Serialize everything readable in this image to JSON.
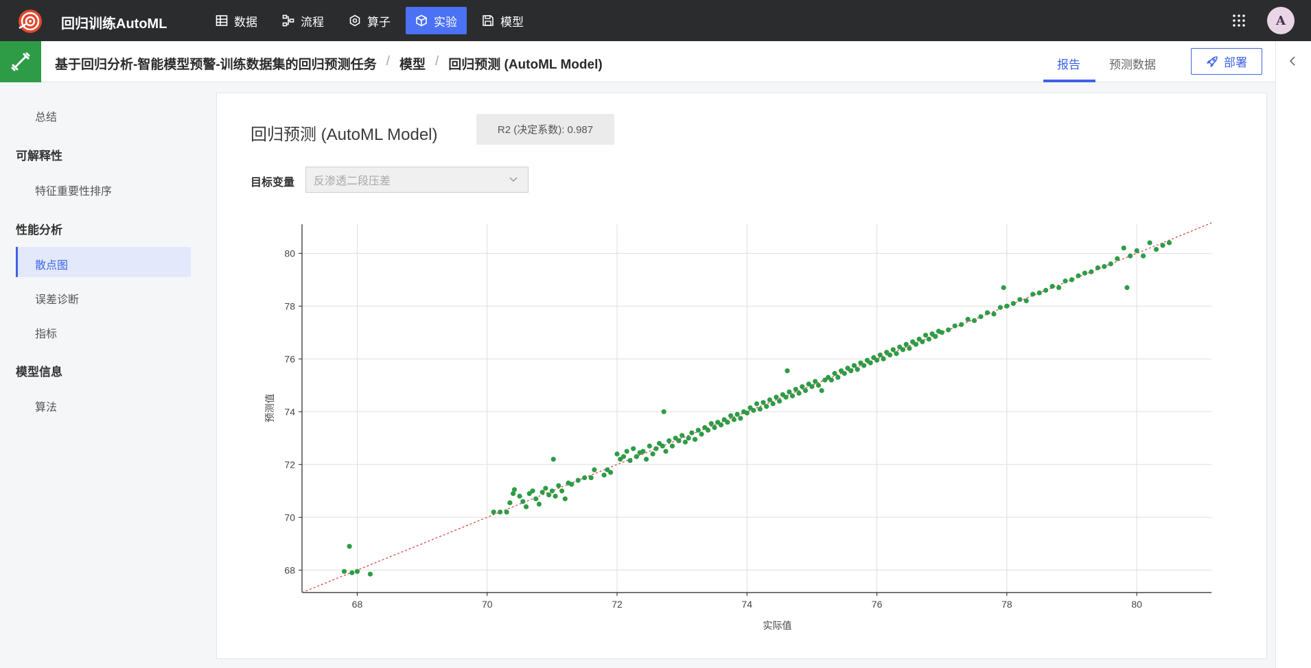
{
  "app": {
    "title": "回归训练AutoML"
  },
  "nav": {
    "items": [
      {
        "label": "数据",
        "icon": "table-icon",
        "active": false
      },
      {
        "label": "流程",
        "icon": "flow-icon",
        "active": false
      },
      {
        "label": "算子",
        "icon": "operator-icon",
        "active": false
      },
      {
        "label": "实验",
        "icon": "cube-icon",
        "active": true
      },
      {
        "label": "模型",
        "icon": "save-icon",
        "active": false
      }
    ],
    "avatar": "A"
  },
  "header": {
    "breadcrumb": [
      "基于回归分析-智能模型预警-训练数据集的回归预测任务",
      "模型",
      "回归预测 (AutoML Model)"
    ],
    "separator": "/",
    "tabs": {
      "report": "报告",
      "predict": "预测数据"
    },
    "deploy_label": "部署"
  },
  "sidebar": {
    "summary": "总结",
    "explain_head": "可解释性",
    "feature_importance": "特征重要性排序",
    "perf_head": "性能分析",
    "scatter": "散点图",
    "error_diag": "误差诊断",
    "metrics": "指标",
    "model_head": "模型信息",
    "algorithm": "算法"
  },
  "main": {
    "title": "回归预测 (AutoML Model)",
    "r2_badge": "R2 (决定系数): 0.987",
    "target_label": "目标变量",
    "target_placeholder": "反渗透二段压差"
  },
  "chart_data": {
    "type": "scatter",
    "xlabel": "实际值",
    "ylabel": "预测值",
    "xlim": [
      67.15,
      81.15
    ],
    "ylim": [
      67.15,
      81.1
    ],
    "xticks": [
      68,
      70,
      72,
      74,
      76,
      78,
      80
    ],
    "yticks": [
      68,
      70,
      72,
      74,
      76,
      78,
      80
    ],
    "grid": true,
    "point_color": "#2e9c47",
    "reference_line": {
      "from": [
        67.15,
        67.15
      ],
      "to": [
        81.15,
        81.15
      ],
      "color": "#d9534f",
      "style": "dashed"
    },
    "points": [
      [
        67.8,
        67.95
      ],
      [
        67.88,
        68.9
      ],
      [
        67.92,
        67.9
      ],
      [
        68.0,
        67.95
      ],
      [
        68.2,
        67.85
      ],
      [
        70.1,
        70.2
      ],
      [
        70.2,
        70.2
      ],
      [
        70.3,
        70.2
      ],
      [
        70.35,
        70.55
      ],
      [
        70.4,
        70.9
      ],
      [
        70.42,
        71.05
      ],
      [
        70.5,
        70.8
      ],
      [
        70.55,
        70.6
      ],
      [
        70.6,
        70.4
      ],
      [
        70.65,
        70.9
      ],
      [
        70.7,
        71.0
      ],
      [
        70.75,
        70.7
      ],
      [
        70.8,
        70.5
      ],
      [
        70.85,
        70.95
      ],
      [
        70.9,
        71.1
      ],
      [
        70.95,
        70.85
      ],
      [
        71.0,
        71.0
      ],
      [
        71.02,
        72.2
      ],
      [
        71.05,
        70.8
      ],
      [
        71.1,
        71.2
      ],
      [
        71.15,
        71.0
      ],
      [
        71.2,
        70.7
      ],
      [
        71.25,
        71.3
      ],
      [
        71.3,
        71.25
      ],
      [
        71.4,
        71.4
      ],
      [
        71.5,
        71.5
      ],
      [
        71.6,
        71.5
      ],
      [
        71.65,
        71.8
      ],
      [
        71.8,
        71.6
      ],
      [
        71.85,
        71.8
      ],
      [
        71.9,
        71.7
      ],
      [
        72.0,
        72.4
      ],
      [
        72.05,
        72.2
      ],
      [
        72.1,
        72.3
      ],
      [
        72.15,
        72.5
      ],
      [
        72.2,
        72.15
      ],
      [
        72.25,
        72.6
      ],
      [
        72.3,
        72.3
      ],
      [
        72.35,
        72.45
      ],
      [
        72.4,
        72.5
      ],
      [
        72.45,
        72.2
      ],
      [
        72.5,
        72.7
      ],
      [
        72.55,
        72.4
      ],
      [
        72.6,
        72.6
      ],
      [
        72.65,
        72.8
      ],
      [
        72.7,
        72.7
      ],
      [
        72.72,
        74.0
      ],
      [
        72.75,
        72.5
      ],
      [
        72.8,
        72.9
      ],
      [
        72.85,
        72.7
      ],
      [
        72.9,
        73.0
      ],
      [
        72.95,
        72.9
      ],
      [
        73.0,
        73.1
      ],
      [
        73.05,
        72.85
      ],
      [
        73.1,
        73.0
      ],
      [
        73.15,
        73.2
      ],
      [
        73.2,
        72.95
      ],
      [
        73.25,
        73.3
      ],
      [
        73.3,
        73.15
      ],
      [
        73.35,
        73.4
      ],
      [
        73.4,
        73.3
      ],
      [
        73.45,
        73.55
      ],
      [
        73.5,
        73.4
      ],
      [
        73.55,
        73.6
      ],
      [
        73.6,
        73.5
      ],
      [
        73.65,
        73.7
      ],
      [
        73.7,
        73.6
      ],
      [
        73.75,
        73.85
      ],
      [
        73.8,
        73.7
      ],
      [
        73.85,
        73.9
      ],
      [
        73.9,
        73.75
      ],
      [
        73.95,
        74.0
      ],
      [
        74.0,
        73.95
      ],
      [
        74.05,
        74.15
      ],
      [
        74.1,
        74.05
      ],
      [
        74.15,
        74.3
      ],
      [
        74.2,
        74.1
      ],
      [
        74.25,
        74.35
      ],
      [
        74.3,
        74.2
      ],
      [
        74.35,
        74.45
      ],
      [
        74.4,
        74.3
      ],
      [
        74.45,
        74.55
      ],
      [
        74.5,
        74.4
      ],
      [
        74.55,
        74.65
      ],
      [
        74.6,
        74.55
      ],
      [
        74.62,
        75.55
      ],
      [
        74.65,
        74.75
      ],
      [
        74.7,
        74.6
      ],
      [
        74.75,
        74.85
      ],
      [
        74.8,
        74.7
      ],
      [
        74.85,
        74.95
      ],
      [
        74.9,
        74.8
      ],
      [
        74.95,
        75.05
      ],
      [
        75.0,
        74.95
      ],
      [
        75.05,
        75.15
      ],
      [
        75.1,
        75.0
      ],
      [
        75.15,
        74.8
      ],
      [
        75.2,
        75.2
      ],
      [
        75.25,
        75.3
      ],
      [
        75.3,
        75.2
      ],
      [
        75.35,
        75.45
      ],
      [
        75.4,
        75.3
      ],
      [
        75.45,
        75.55
      ],
      [
        75.5,
        75.45
      ],
      [
        75.55,
        75.65
      ],
      [
        75.6,
        75.55
      ],
      [
        75.65,
        75.75
      ],
      [
        75.7,
        75.6
      ],
      [
        75.75,
        75.85
      ],
      [
        75.8,
        75.75
      ],
      [
        75.85,
        75.95
      ],
      [
        75.9,
        75.85
      ],
      [
        75.95,
        76.05
      ],
      [
        76.0,
        75.95
      ],
      [
        76.05,
        76.15
      ],
      [
        76.1,
        76.0
      ],
      [
        76.15,
        76.25
      ],
      [
        76.2,
        76.15
      ],
      [
        76.25,
        76.35
      ],
      [
        76.3,
        76.2
      ],
      [
        76.35,
        76.45
      ],
      [
        76.4,
        76.35
      ],
      [
        76.45,
        76.55
      ],
      [
        76.5,
        76.4
      ],
      [
        76.55,
        76.65
      ],
      [
        76.6,
        76.55
      ],
      [
        76.65,
        76.75
      ],
      [
        76.7,
        76.65
      ],
      [
        76.75,
        76.9
      ],
      [
        76.8,
        76.75
      ],
      [
        76.85,
        76.95
      ],
      [
        76.9,
        76.85
      ],
      [
        76.95,
        77.05
      ],
      [
        77.0,
        77.0
      ],
      [
        77.1,
        77.1
      ],
      [
        77.2,
        77.25
      ],
      [
        77.3,
        77.3
      ],
      [
        77.4,
        77.5
      ],
      [
        77.5,
        77.45
      ],
      [
        77.6,
        77.6
      ],
      [
        77.7,
        77.75
      ],
      [
        77.8,
        77.7
      ],
      [
        77.9,
        77.95
      ],
      [
        77.95,
        78.7
      ],
      [
        78.0,
        78.0
      ],
      [
        78.1,
        78.1
      ],
      [
        78.2,
        78.25
      ],
      [
        78.3,
        78.2
      ],
      [
        78.4,
        78.45
      ],
      [
        78.5,
        78.5
      ],
      [
        78.6,
        78.6
      ],
      [
        78.7,
        78.75
      ],
      [
        78.8,
        78.7
      ],
      [
        78.9,
        78.95
      ],
      [
        79.0,
        79.0
      ],
      [
        79.1,
        79.15
      ],
      [
        79.2,
        79.25
      ],
      [
        79.3,
        79.3
      ],
      [
        79.4,
        79.45
      ],
      [
        79.5,
        79.5
      ],
      [
        79.6,
        79.6
      ],
      [
        79.7,
        79.8
      ],
      [
        79.8,
        80.2
      ],
      [
        79.85,
        78.7
      ],
      [
        79.9,
        79.9
      ],
      [
        80.0,
        80.1
      ],
      [
        80.1,
        79.9
      ],
      [
        80.2,
        80.4
      ],
      [
        80.3,
        80.15
      ],
      [
        80.4,
        80.3
      ],
      [
        80.5,
        80.4
      ]
    ]
  }
}
